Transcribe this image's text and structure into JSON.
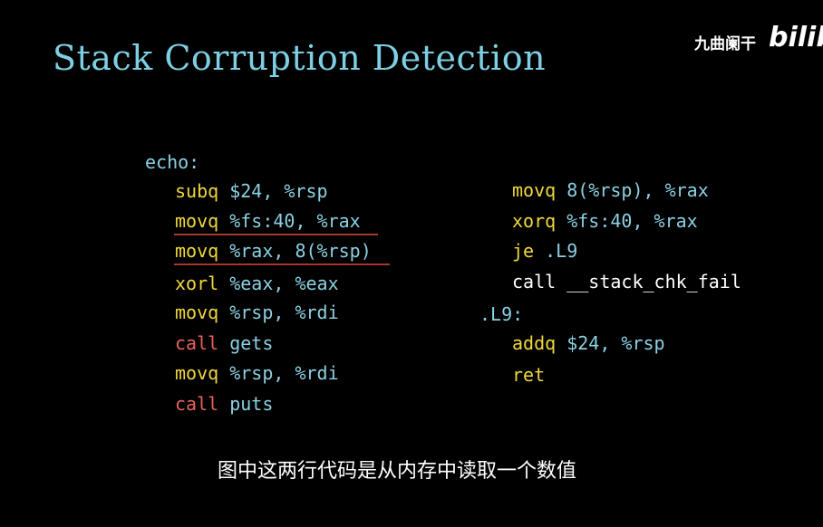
{
  "slide": {
    "title": "Stack Corruption Detection"
  },
  "watermark": {
    "channel_name": "九曲阑干",
    "logo_text": "bilibili"
  },
  "code_left": {
    "label": "echo:",
    "lines": [
      {
        "instr": "subq",
        "operands": "$24, %rsp"
      },
      {
        "instr": "movq",
        "operands": "%fs:40, %rax"
      },
      {
        "instr": "movq",
        "operands": "%rax, 8(%rsp)"
      },
      {
        "instr": "xorl",
        "operands": "%eax, %eax"
      },
      {
        "instr": "movq",
        "operands": "%rsp, %rdi"
      },
      {
        "instr": "call",
        "operands": "gets"
      },
      {
        "instr": "movq",
        "operands": "%rsp, %rdi"
      },
      {
        "instr": "call",
        "operands": "puts"
      }
    ]
  },
  "code_right": {
    "lines": [
      {
        "instr": "movq",
        "operands": "8(%rsp), %rax"
      },
      {
        "instr": "xorq",
        "operands": "%fs:40, %rax"
      },
      {
        "instr": "je",
        "operands": ".L9"
      },
      {
        "instr": "call",
        "operands": "__stack_chk_fail"
      }
    ],
    "label": ".L9:",
    "tail": [
      {
        "instr": "addq",
        "operands": "$24, %rsp"
      },
      {
        "instr": "ret",
        "operands": ""
      }
    ]
  },
  "caption": {
    "text": "图中这两行代码是从内存中读取一个数值"
  }
}
